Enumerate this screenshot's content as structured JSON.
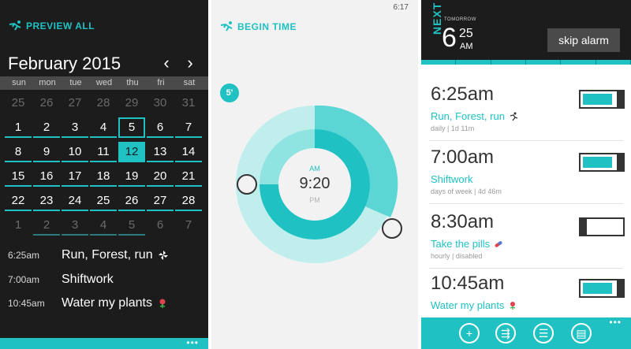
{
  "colors": {
    "accent": "#1fc1c3",
    "dark": "#1c1c1c",
    "light": "#f2f2f2"
  },
  "calendar": {
    "header_label": "PREVIEW ALL",
    "month_label": "February 2015",
    "prev_icon": "chevron-left-icon",
    "next_icon": "chevron-right-icon",
    "weekdays": [
      "sun",
      "mon",
      "tue",
      "wed",
      "thu",
      "fri",
      "sat"
    ],
    "weeks": [
      [
        "25",
        "26",
        "27",
        "28",
        "29",
        "30",
        "31"
      ],
      [
        "1",
        "2",
        "3",
        "4",
        "5",
        "6",
        "7"
      ],
      [
        "8",
        "9",
        "10",
        "11",
        "12",
        "13",
        "14"
      ],
      [
        "15",
        "16",
        "17",
        "18",
        "19",
        "20",
        "21"
      ],
      [
        "22",
        "23",
        "24",
        "25",
        "26",
        "27",
        "28"
      ],
      [
        "1",
        "2",
        "3",
        "4",
        "5",
        "6",
        "7"
      ]
    ],
    "selected_day": "12",
    "today_day": "5",
    "events": [
      {
        "time": "6:25am",
        "name": "Run, Forest, run",
        "icon": "windmill-icon"
      },
      {
        "time": "7:00am",
        "name": "Shiftwork",
        "icon": ""
      },
      {
        "time": "10:45am",
        "name": "Water my plants",
        "icon": "flower-icon"
      }
    ],
    "more_label": "•••"
  },
  "timepicker": {
    "status_time": "6:17",
    "header_label": "BEGIN TIME",
    "step_badge": "5'",
    "am_label": "AM",
    "time_value": "9:20",
    "pm_label": "PM"
  },
  "alarms": {
    "next_label": "NEXT",
    "tomorrow_label": "TOMORROW",
    "next_hour": "6",
    "next_minutes": "25",
    "next_ampm": "AM",
    "skip_label": "skip alarm",
    "items": [
      {
        "time": "6:25am",
        "name": "Run, Forest, run",
        "meta": "daily | 1d 11m",
        "enabled": true,
        "icon": "runner-icon"
      },
      {
        "time": "7:00am",
        "name": "Shiftwork",
        "meta": "days of week | 4d 46m",
        "enabled": true,
        "icon": ""
      },
      {
        "time": "8:30am",
        "name": "Take the pills",
        "meta": "hourly | disabled",
        "enabled": false,
        "icon": "pill-icon"
      },
      {
        "time": "10:45am",
        "name": "Water my plants",
        "meta": "",
        "enabled": true,
        "icon": "flower-icon"
      }
    ],
    "appbar": [
      {
        "icon": "add-icon"
      },
      {
        "icon": "add-event-icon"
      },
      {
        "icon": "list-icon"
      },
      {
        "icon": "calendar-list-icon"
      }
    ],
    "more_label": "•••"
  }
}
